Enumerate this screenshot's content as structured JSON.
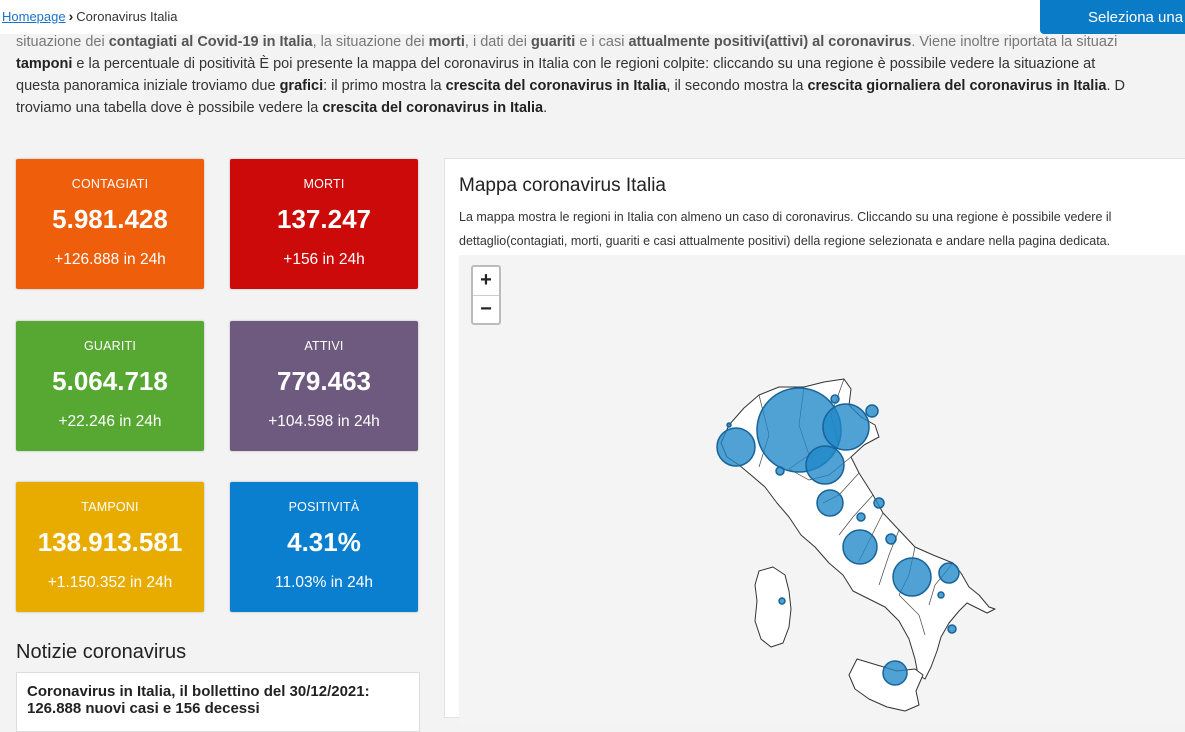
{
  "breadcrumb": {
    "home": "Homepage",
    "current": "Coronavirus Italia"
  },
  "header": {
    "select_button": "Seleziona una"
  },
  "intro": {
    "line0": [
      {
        "t": "situazione dei "
      },
      {
        "t": "contagiati al Covid-19 in Italia",
        "b": true
      },
      {
        "t": ", la situazione dei "
      },
      {
        "t": "morti",
        "b": true
      },
      {
        "t": ", i dati dei "
      },
      {
        "t": "guariti",
        "b": true
      },
      {
        "t": " e i casi "
      },
      {
        "t": "attualmente positivi(attivi) al coronavirus",
        "b": true
      },
      {
        "t": ". Viene inoltre riportata la situazi"
      }
    ],
    "line1": [
      {
        "t": "tamponi",
        "b": true
      },
      {
        "t": " e la percentuale di positività È poi presente la mappa del coronavirus in Italia con le regioni colpite: cliccando su una regione è possibile vedere la situazione at"
      }
    ],
    "line2": [
      {
        "t": "questa panoramica iniziale troviamo due "
      },
      {
        "t": "grafici",
        "b": true
      },
      {
        "t": ": il primo mostra la "
      },
      {
        "t": "crescita del coronavirus in Italia",
        "b": true
      },
      {
        "t": ", il secondo mostra la "
      },
      {
        "t": "crescita giornaliera del coronavirus in Italia",
        "b": true
      },
      {
        "t": ". D"
      }
    ],
    "line3": [
      {
        "t": "troviamo una tabella dove è possibile vedere la "
      },
      {
        "t": "crescita del coronavirus in Italia",
        "b": true
      },
      {
        "t": "."
      }
    ]
  },
  "stats": [
    {
      "label": "CONTAGIATI",
      "value": "5.981.428",
      "delta": "+126.888 in 24h",
      "color": "#ee5e0b"
    },
    {
      "label": "MORTI",
      "value": "137.247",
      "delta": "+156 in 24h",
      "color": "#cc0a0a"
    },
    {
      "label": "GUARITI",
      "value": "5.064.718",
      "delta": "+22.246 in 24h",
      "color": "#56a832"
    },
    {
      "label": "ATTIVI",
      "value": "779.463",
      "delta": "+104.598 in 24h",
      "color": "#6e5a7e"
    },
    {
      "label": "TAMPONI",
      "value": "138.913.581",
      "delta": "+1.150.352 in 24h",
      "color": "#e8ab00"
    },
    {
      "label": "POSITIVITÀ",
      "value": "4.31%",
      "delta": "11.03% in 24h",
      "color": "#0a7fd0"
    }
  ],
  "news": {
    "title": "Notizie coronavirus",
    "item_line1": "Coronavirus in Italia, il bollettino del 30/12/2021:",
    "item_line2": "126.888 nuovi casi e 156 decessi"
  },
  "map": {
    "title": "Mappa coronavirus Italia",
    "description": "La mappa mostra le regioni in Italia con almeno un caso di coronavirus. Cliccando su una regione è possibile vedere il dettaglio(contagiati, morti, guariti e casi attualmente positivi) della regione selezionata e andare nella pagina dedicata.",
    "zoom_in": "+",
    "zoom_out": "−",
    "bubble_color": "#1f86c8"
  }
}
